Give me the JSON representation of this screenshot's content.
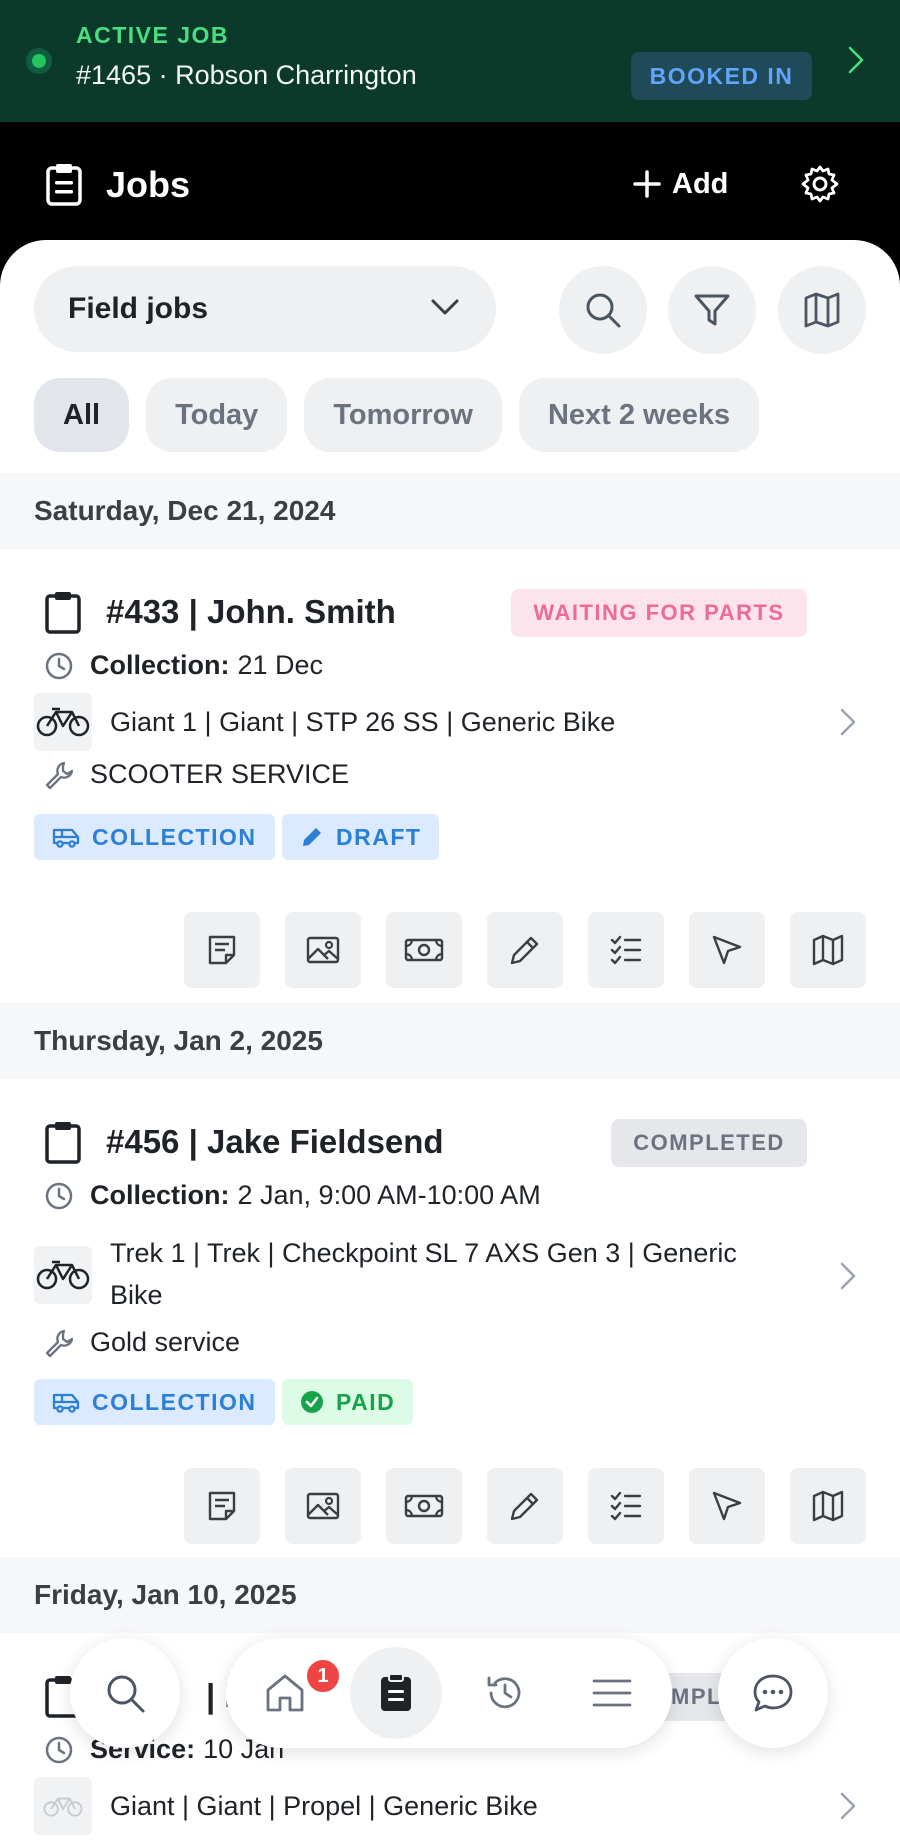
{
  "active_job": {
    "label": "ACTIVE JOB",
    "title": "#1465 · Robson Charrington",
    "status": "BOOKED IN"
  },
  "header": {
    "title": "Jobs",
    "add_label": "Add"
  },
  "filters": {
    "dropdown_value": "Field jobs",
    "chips": [
      "All",
      "Today",
      "Tomorrow",
      "Next 2 weeks"
    ],
    "active_chip": "All"
  },
  "groups": [
    {
      "date": "Saturday, Dec 21, 2024",
      "job": {
        "title": "#433 | John. Smith",
        "status": "WAITING FOR PARTS",
        "schedule_label": "Collection:",
        "schedule_value": "21 Dec",
        "bike": "Giant 1 | Giant | STP 26 SS | Generic Bike",
        "service": "SCOOTER SERVICE",
        "tags": [
          "COLLECTION",
          "DRAFT"
        ]
      }
    },
    {
      "date": "Thursday, Jan 2, 2025",
      "job": {
        "title": "#456 | Jake Fieldsend",
        "status": "COMPLETED",
        "schedule_label": "Collection:",
        "schedule_value": "2 Jan, 9:00 AM-10:00 AM",
        "bike": "Trek 1 | Trek | Checkpoint SL 7 AXS Gen 3 | Generic Bike",
        "service": "Gold service",
        "tags": [
          "COLLECTION",
          "PAID"
        ]
      }
    },
    {
      "date": "Friday, Jan 10, 2025",
      "job": {
        "title_partial": "| R",
        "status_partial": "MPL",
        "schedule_label": "Service:",
        "schedule_value": "10 Jan",
        "bike": "Giant  | Giant | Propel | Generic Bike"
      }
    }
  ],
  "bottom_nav": {
    "home_badge": "1"
  },
  "colors": {
    "banner_bg": "#0b3a2b",
    "accent_green": "#22c55e",
    "waiting_pink": "#ec6b97",
    "tag_blue": "#2b7fd6",
    "paid_green": "#16a34a",
    "badge_red": "#ef4444"
  }
}
